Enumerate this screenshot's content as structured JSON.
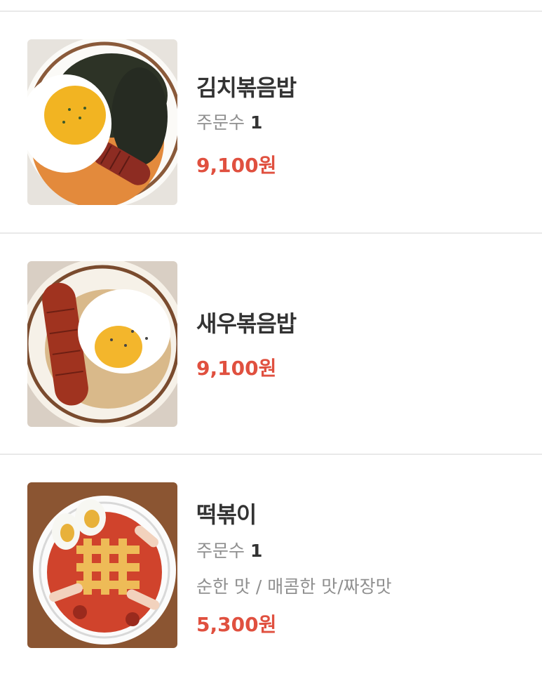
{
  "menu_items": [
    {
      "name": "김치볶음밥",
      "orders_label": "주문수",
      "orders_count": "1",
      "price": "9,100원",
      "image_icon": "kimchi-fried-rice-photo"
    },
    {
      "name": "새우볶음밥",
      "price": "9,100원",
      "image_icon": "shrimp-fried-rice-photo"
    },
    {
      "name": "떡볶이",
      "orders_label": "주문수",
      "orders_count": "1",
      "option": "순한 맛 / 매콤한 맛/짜장맛",
      "price": "5,300원",
      "image_icon": "tteokbokki-photo"
    }
  ],
  "colors": {
    "price": "#e0503f",
    "name": "#333333",
    "secondary": "#8f8f8f",
    "divider": "#e9e9e9"
  }
}
